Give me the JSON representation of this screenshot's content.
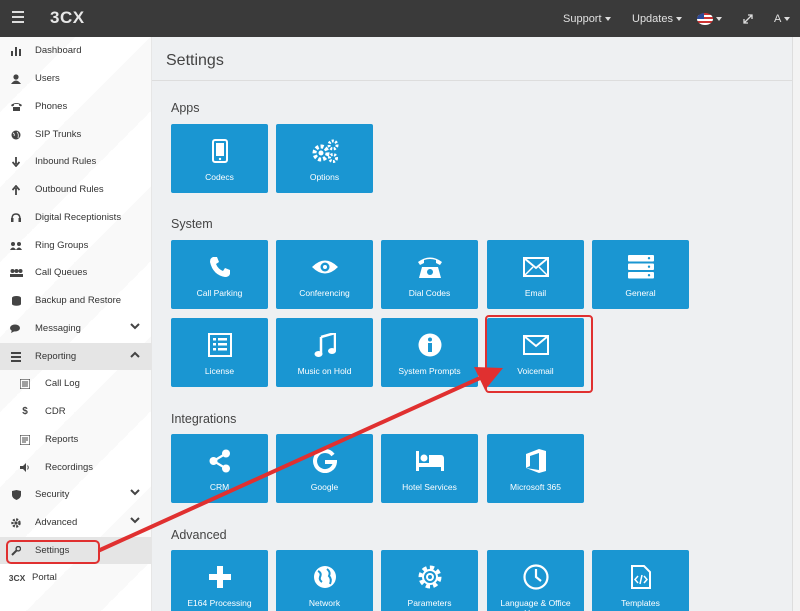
{
  "topbar": {
    "logo": "3CX",
    "support": "Support",
    "updates": "Updates",
    "user": "A"
  },
  "sidebar": {
    "items": [
      {
        "label": "Dashboard",
        "icon": "bar-chart-icon"
      },
      {
        "label": "Users",
        "icon": "user-icon"
      },
      {
        "label": "Phones",
        "icon": "phone-icon"
      },
      {
        "label": "SIP Trunks",
        "icon": "globe-icon"
      },
      {
        "label": "Inbound Rules",
        "icon": "arrow-down-icon"
      },
      {
        "label": "Outbound Rules",
        "icon": "arrow-up-icon"
      },
      {
        "label": "Digital Receptionists",
        "icon": "headset-icon"
      },
      {
        "label": "Ring Groups",
        "icon": "group-icon"
      },
      {
        "label": "Call Queues",
        "icon": "queue-icon"
      },
      {
        "label": "Backup and Restore",
        "icon": "database-icon"
      },
      {
        "label": "Messaging",
        "icon": "chat-icon"
      },
      {
        "label": "Reporting",
        "icon": "list-icon"
      },
      {
        "label": "Call Log",
        "icon": "list-icon"
      },
      {
        "label": "CDR",
        "icon": "dollar-icon"
      },
      {
        "label": "Reports",
        "icon": "report-icon"
      },
      {
        "label": "Recordings",
        "icon": "speaker-icon"
      },
      {
        "label": "Security",
        "icon": "shield-icon"
      },
      {
        "label": "Advanced",
        "icon": "gear-icon"
      },
      {
        "label": "Settings",
        "icon": "wrench-icon"
      },
      {
        "label": "Portal",
        "icon": "3cx-icon",
        "prefix": "3CX"
      }
    ]
  },
  "main": {
    "title": "Settings",
    "sections": {
      "apps": "Apps",
      "system": "System",
      "integrations": "Integrations",
      "advanced": "Advanced"
    },
    "apps": [
      "Codecs",
      "Options"
    ],
    "system": [
      "Call Parking",
      "Conferencing",
      "Dial Codes",
      "Email",
      "General",
      "License",
      "Music on Hold",
      "System Prompts",
      "Voicemail"
    ],
    "integrations": [
      "CRM",
      "Google",
      "Hotel Services",
      "Microsoft 365"
    ],
    "advanced": [
      "E164 Processing",
      "Network",
      "Parameters",
      "Language & Office Hours",
      "Templates"
    ]
  },
  "colors": {
    "tile": "#1a96d2",
    "topbar": "#3a3a3a",
    "highlight": "#e03030"
  }
}
